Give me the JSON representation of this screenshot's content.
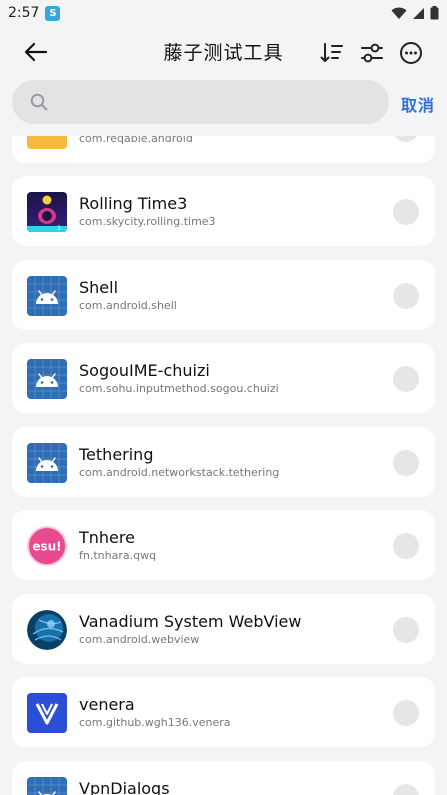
{
  "status": {
    "time": "2:57"
  },
  "header": {
    "title": "藤子测试工具"
  },
  "search": {
    "placeholder": "",
    "cancel_label": "取消"
  },
  "icons": {
    "back": "back-arrow-icon",
    "sort": "sort-icon",
    "filter": "filter-sliders-icon",
    "more": "more-icon"
  },
  "apps": [
    {
      "name": "",
      "package": "com.reqable.android",
      "icon": "reqable-icon"
    },
    {
      "name": "Rolling Time3",
      "package": "com.skycity.rolling.time3",
      "icon": "rolling-time-icon"
    },
    {
      "name": "Shell",
      "package": "com.android.shell",
      "icon": "android-icon"
    },
    {
      "name": "SogouIME-chuizi",
      "package": "com.sohu.inputmethod.sogou.chuizi",
      "icon": "android-icon"
    },
    {
      "name": "Tethering",
      "package": "com.android.networkstack.tethering",
      "icon": "android-icon"
    },
    {
      "name": "Tnhere",
      "package": "fn.tnhara.qwq",
      "icon": "esu-icon",
      "icon_text": "esu!"
    },
    {
      "name": "Vanadium System WebView",
      "package": "com.android.webview",
      "icon": "globe-icon"
    },
    {
      "name": "venera",
      "package": "com.github.wgh136.venera",
      "icon": "venera-icon"
    },
    {
      "name": "VpnDialogs",
      "package": "",
      "icon": "android-icon"
    }
  ],
  "colors": {
    "accent": "#2f6fe0",
    "background": "#f4f4f6",
    "card": "#ffffff"
  }
}
